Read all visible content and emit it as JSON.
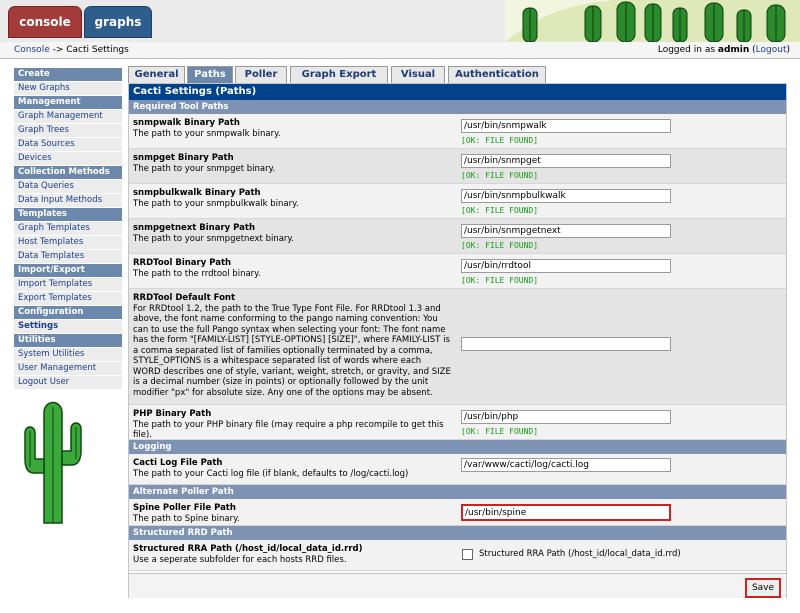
{
  "header": {
    "tabs": [
      {
        "label": "console"
      },
      {
        "label": "graphs"
      }
    ]
  },
  "breadcrumb": {
    "home": "Console",
    "separator": " -> ",
    "current": "Cacti Settings"
  },
  "login": {
    "prefix": "Logged in as ",
    "user": "admin",
    "open": " (",
    "logout": "Logout",
    "close": ")"
  },
  "sidebar": {
    "sections": [
      {
        "title": "Create",
        "items": [
          "New Graphs"
        ]
      },
      {
        "title": "Management",
        "items": [
          "Graph Management",
          "Graph Trees",
          "Data Sources",
          "Devices"
        ]
      },
      {
        "title": "Collection Methods",
        "items": [
          "Data Queries",
          "Data Input Methods"
        ]
      },
      {
        "title": "Templates",
        "items": [
          "Graph Templates",
          "Host Templates",
          "Data Templates"
        ]
      },
      {
        "title": "Import/Export",
        "items": [
          "Import Templates",
          "Export Templates"
        ]
      },
      {
        "title": "Configuration",
        "items": [
          "Settings"
        ]
      },
      {
        "title": "Utilities",
        "items": [
          "System Utilities",
          "User Management",
          "Logout User"
        ]
      }
    ],
    "active_item": "Settings"
  },
  "settings_tabs": [
    "General",
    "Paths",
    "Poller",
    "Graph Export",
    "Visual",
    "Authentication"
  ],
  "active_tab": "Paths",
  "panel_title": "Cacti Settings (Paths)",
  "sections": {
    "required": "Required Tool Paths",
    "logging": "Logging",
    "alt_poller": "Alternate Poller Path",
    "structured": "Structured RRD Path"
  },
  "fields": {
    "snmpwalk": {
      "title": "snmpwalk Binary Path",
      "desc": "The path to your snmpwalk binary.",
      "value": "/usr/bin/snmpwalk",
      "status": "[OK: FILE FOUND]"
    },
    "snmpget": {
      "title": "snmpget Binary Path",
      "desc": "The path to your snmpget binary.",
      "value": "/usr/bin/snmpget",
      "status": "[OK: FILE FOUND]"
    },
    "snmpbulkwalk": {
      "title": "snmpbulkwalk Binary Path",
      "desc": "The path to your snmpbulkwalk binary.",
      "value": "/usr/bin/snmpbulkwalk",
      "status": "[OK: FILE FOUND]"
    },
    "snmpgetnext": {
      "title": "snmpgetnext Binary Path",
      "desc": "The path to your snmpgetnext binary.",
      "value": "/usr/bin/snmpgetnext",
      "status": "[OK: FILE FOUND]"
    },
    "rrdtool": {
      "title": "RRDTool Binary Path",
      "desc": "The path to the rrdtool binary.",
      "value": "/usr/bin/rrdtool",
      "status": "[OK: FILE FOUND]"
    },
    "rrdfont": {
      "title": "RRDTool Default Font",
      "desc": "For RRDtool 1.2, the path to the True Type Font File. For RRDtool 1.3 and above, the font name conforming to the pango naming convention: You can to use the full Pango syntax when selecting your font: The font name has the form \"[FAMILY-LIST] [STYLE-OPTIONS] [SIZE]\", where FAMILY-LIST is a comma separated list of families optionally terminated by a comma, STYLE_OPTIONS is a whitespace separated list of words where each WORD describes one of style, variant, weight, stretch, or gravity, and SIZE is a decimal number (size in points) or optionally followed by the unit modifier \"px\" for absolute size. Any one of the options may be absent.",
      "value": ""
    },
    "php": {
      "title": "PHP Binary Path",
      "desc": "The path to your PHP binary file (may require a php recompile to get this file).",
      "value": "/usr/bin/php",
      "status": "[OK: FILE FOUND]"
    },
    "cactilog": {
      "title": "Cacti Log File Path",
      "desc": "The path to your Cacti log file (if blank, defaults to /log/cacti.log)",
      "value": "/var/www/cacti/log/cacti.log"
    },
    "spine": {
      "title": "Spine Poller File Path",
      "desc": "The path to Spine binary.",
      "value": "/usr/bin/spine"
    },
    "structured": {
      "title": "Structured RRA Path (/host_id/local_data_id.rrd)",
      "desc": "Use a seperate subfolder for each hosts RRD files.",
      "checkbox_label": "Structured RRA Path (/host_id/local_data_id.rrd)"
    }
  },
  "save_label": "Save"
}
